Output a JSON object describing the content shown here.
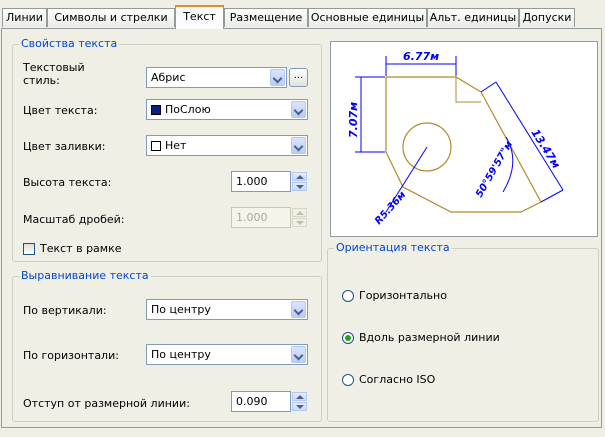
{
  "tabs": [
    {
      "label": "Линии",
      "active": false
    },
    {
      "label": "Символы и стрелки",
      "active": false
    },
    {
      "label": "Текст",
      "active": true
    },
    {
      "label": "Размещение",
      "active": false
    },
    {
      "label": "Основные единицы",
      "active": false
    },
    {
      "label": "Альт. единицы",
      "active": false
    },
    {
      "label": "Допуски",
      "active": false
    }
  ],
  "text_props": {
    "title": "Свойства текста",
    "text_style_label": "Текстовый стиль:",
    "text_style_value": "Абрис",
    "ellipsis": "...",
    "text_color_label": "Цвет текста:",
    "text_color_value": "ПоСлою",
    "fill_color_label": "Цвет заливки:",
    "fill_color_value": "Нет",
    "text_height_label": "Высота текста:",
    "text_height_value": "1.000",
    "fraction_scale_label": "Масштаб дробей:",
    "fraction_scale_value": "1.000",
    "frame_label": "Текст в рамке",
    "frame_checked": false
  },
  "alignment": {
    "title": "Выравнивание текста",
    "vertical_label": "По вертикали:",
    "vertical_value": "По центру",
    "horizontal_label": "По горизонтали:",
    "horizontal_value": "По центру",
    "offset_label": "Отступ от размерной линии:",
    "offset_value": "0.090"
  },
  "orientation": {
    "title": "Ориентация текста",
    "options": [
      "Горизонтально",
      "Вдоль размерной линии",
      "Согласно ISO"
    ],
    "selected": 1
  },
  "preview": {
    "dim_top": "6.77м",
    "dim_left": "7.07м",
    "dim_right": "13.47м",
    "dim_angle": "50°59'57\"м",
    "dim_radius": "R5.36м",
    "colors": {
      "geometry": "#b08a2a",
      "dimension": "#0000ff",
      "text": "#0000ff"
    }
  },
  "colors": {
    "accent": "#0046d5",
    "tab_highlight": "#e68b2c",
    "radio_dot": "#21a121"
  }
}
